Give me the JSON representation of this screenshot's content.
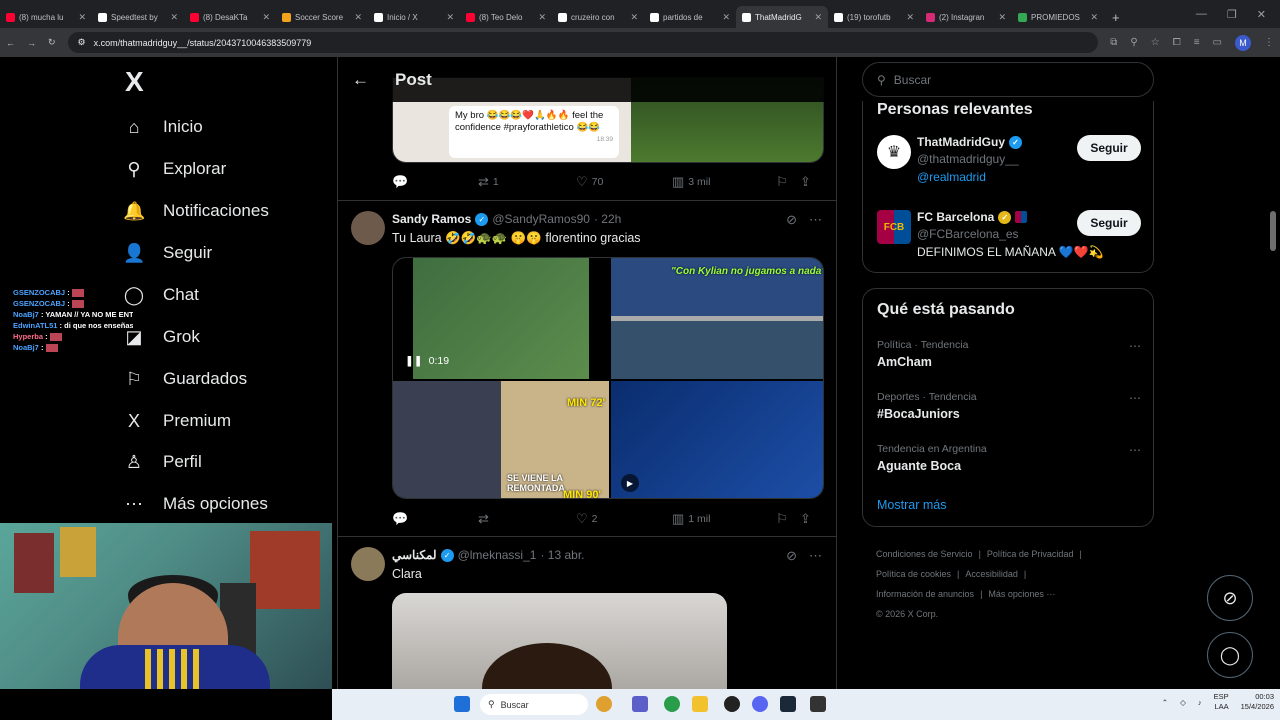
{
  "browser": {
    "tabs": [
      {
        "label": "(8) mucha lu",
        "color": "#ff0033"
      },
      {
        "label": "Speedtest by",
        "color": "#ffffff"
      },
      {
        "label": "(8) DesaKTa",
        "color": "#ff0033"
      },
      {
        "label": "Soccer Score",
        "color": "#f3a21c"
      },
      {
        "label": "Inicio / X",
        "color": "#ffffff"
      },
      {
        "label": "(8) Teo Delo",
        "color": "#ff0033"
      },
      {
        "label": "cruzeiro con",
        "color": "#ffffff"
      },
      {
        "label": "partidos de",
        "color": "#ffffff"
      },
      {
        "label": "ThatMadridG",
        "color": "#ffffff",
        "active": true
      },
      {
        "label": "(19) torofutb",
        "color": "#ffffff"
      },
      {
        "label": "(2) Instagran",
        "color": "#d62976"
      },
      {
        "label": "PROMIEDOS",
        "color": "#34a853"
      }
    ],
    "url": "x.com/thatmadridguy__/status/2043710046383509779",
    "profile_initial": "M",
    "win_minimize": "—",
    "win_maximize": "❐",
    "win_close": "✕"
  },
  "leftnav": {
    "logo": "X",
    "items": [
      {
        "label": "Inicio",
        "icon": "home-icon",
        "glyph": "⌂"
      },
      {
        "label": "Explorar",
        "icon": "search-icon",
        "glyph": "⚲"
      },
      {
        "label": "Notificaciones",
        "icon": "bell-icon",
        "glyph": "🔔"
      },
      {
        "label": "Seguir",
        "icon": "follow-icon",
        "glyph": "👤"
      },
      {
        "label": "Chat",
        "icon": "chat-icon",
        "glyph": "◯"
      },
      {
        "label": "Grok",
        "icon": "grok-icon",
        "glyph": "◪"
      },
      {
        "label": "Guardados",
        "icon": "bookmark-icon",
        "glyph": "⚐"
      },
      {
        "label": "Premium",
        "icon": "x-premium-icon",
        "glyph": "X"
      },
      {
        "label": "Perfil",
        "icon": "profile-icon",
        "glyph": "♙"
      },
      {
        "label": "Más opciones",
        "icon": "more-icon",
        "glyph": "⋯"
      }
    ]
  },
  "stream_chat": [
    {
      "user": "GSENZOCABJ",
      "msg": ":",
      "type": "u"
    },
    {
      "user": "GSENZOCABJ",
      "msg": ":",
      "type": "u"
    },
    {
      "user": "NoaBj7",
      "msg": ": YAMAN // YA NO ME ENTRA",
      "type": "u"
    },
    {
      "user": "EdwinATL51",
      "msg": ": di que nos enseñas tus pies",
      "type": "u"
    },
    {
      "user": "Hyperba",
      "msg": ":",
      "type": "u2"
    },
    {
      "user": "NoaBj7",
      "msg": ":",
      "type": "u"
    }
  ],
  "feed": {
    "header_title": "Post",
    "top_tweet": {
      "bubble_text": "My bro 😂😂😂❤️🙏🔥🔥 feel the confidence #prayforathletico 😂😂",
      "bubble_time": "18:39",
      "replies": "",
      "retweets": "1",
      "likes": "70",
      "views": "3 mil"
    },
    "tweet1": {
      "name": "Sandy Ramos",
      "handle": "@SandyRamos90",
      "time": "· 22h",
      "text": "Tu Laura 🤣🤣🐢🐢 🤫🤫 florentino gracias",
      "video_time": "0:19",
      "overlay_top": "\"Con Kylian no jugamos a nada\"",
      "overlay_min72": "MIN 72'",
      "overlay_remontada": "SE VIENE LA REMONTADA",
      "overlay_min90": "MIN 90'",
      "replies": "",
      "retweets": "",
      "likes": "2",
      "views": "1 mil"
    },
    "tweet2": {
      "name": "لمكناسي",
      "handle": "@lmeknassi_1",
      "time": "· 13 abr.",
      "text": "Clara"
    }
  },
  "right": {
    "search_placeholder": "Buscar",
    "relevant_title": "Personas relevantes",
    "people": [
      {
        "name": "ThatMadridGuy",
        "handle": "@thatmadridguy__",
        "bio": "@realmadrid",
        "bio_is_link": true,
        "follow": "Seguir"
      },
      {
        "name": "FC Barcelona",
        "handle": "@FCBarcelona_es",
        "bio": "DEFINIMOS EL MAÑANA 💙❤️💫",
        "bio_is_link": false,
        "follow": "Seguir"
      }
    ],
    "trending_title": "Qué está pasando",
    "trends": [
      {
        "category": "Política · Tendencia",
        "topic": "AmCham"
      },
      {
        "category": "Deportes · Tendencia",
        "topic": "#BocaJuniors"
      },
      {
        "category": "Tendencia en Argentina",
        "topic": "Aguante Boca"
      }
    ],
    "show_more": "Mostrar más",
    "footer": [
      "Condiciones de Servicio",
      "|",
      "Política de Privacidad",
      "|",
      "Política de cookies",
      "|",
      "Accesibilidad",
      "|",
      "Información de anuncios",
      "|",
      "Más opciones ···",
      "© 2026 X Corp."
    ]
  },
  "taskbar": {
    "search": "Buscar",
    "lang": "ESP",
    "lang2": "LAA",
    "time": "00:03",
    "date": "15/4/2026"
  }
}
